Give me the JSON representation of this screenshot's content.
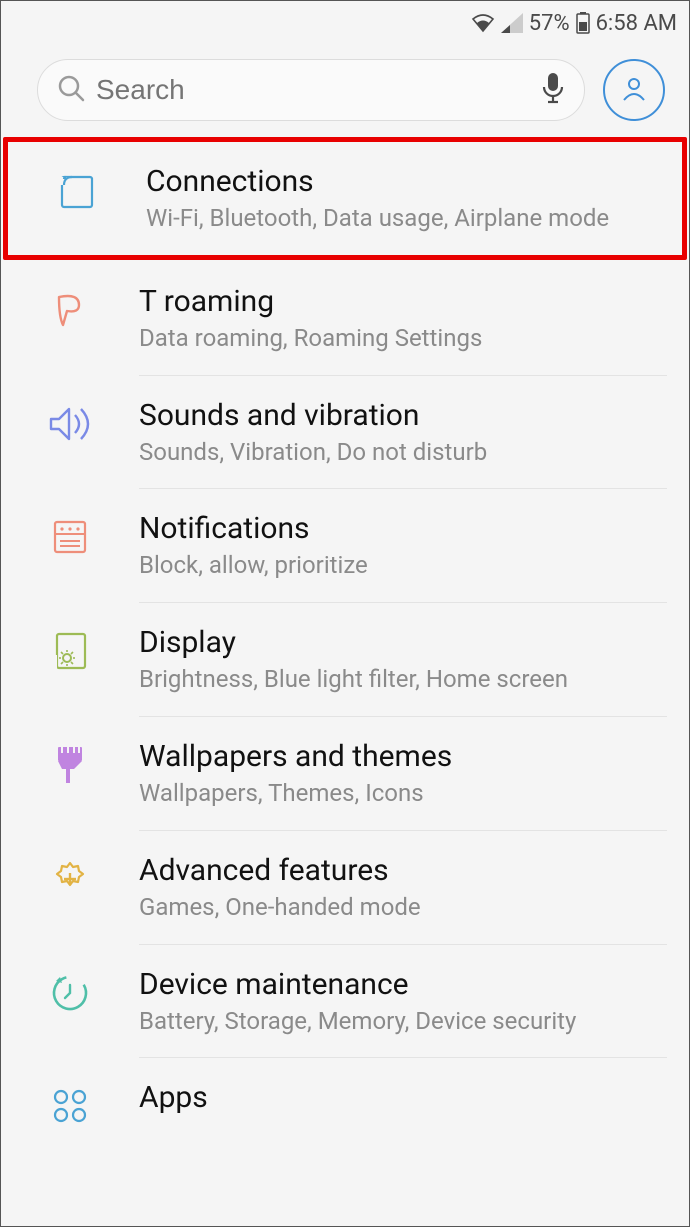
{
  "status": {
    "battery_pct": "57%",
    "time": "6:58 AM"
  },
  "search": {
    "placeholder": "Search"
  },
  "items": [
    {
      "title": "Connections",
      "subtitle": "Wi-Fi, Bluetooth, Data usage, Airplane mode"
    },
    {
      "title": "T roaming",
      "subtitle": "Data roaming, Roaming Settings"
    },
    {
      "title": "Sounds and vibration",
      "subtitle": "Sounds, Vibration, Do not disturb"
    },
    {
      "title": "Notifications",
      "subtitle": "Block, allow, prioritize"
    },
    {
      "title": "Display",
      "subtitle": "Brightness, Blue light filter, Home screen"
    },
    {
      "title": "Wallpapers and themes",
      "subtitle": "Wallpapers, Themes, Icons"
    },
    {
      "title": "Advanced features",
      "subtitle": "Games, One-handed mode"
    },
    {
      "title": "Device maintenance",
      "subtitle": "Battery, Storage, Memory, Device security"
    },
    {
      "title": "Apps",
      "subtitle": ""
    }
  ]
}
